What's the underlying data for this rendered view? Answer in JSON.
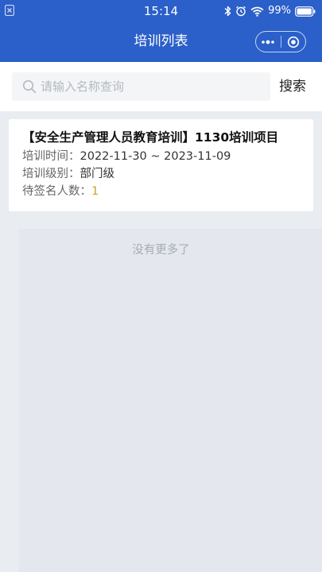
{
  "status_bar": {
    "time": "15:14",
    "battery": "99%",
    "icons": [
      "close-icon",
      "bluetooth-icon",
      "alarm-icon",
      "wifi-icon",
      "battery-icon"
    ]
  },
  "nav": {
    "title": "培训列表",
    "capsule_icons": [
      "more-icon",
      "target-icon"
    ]
  },
  "search": {
    "placeholder": "请输入名称查询",
    "value": "",
    "button_label": "搜索"
  },
  "trainings": [
    {
      "title": "【安全生产管理人员教育培训】1130培训项目",
      "time_label": "培训时间：",
      "time_value": "2022-11-30 ~ 2023-11-09",
      "level_label": "培训级别：",
      "level_value": "部门级",
      "pending_label": "待签名人数：",
      "pending_value": "1"
    }
  ],
  "no_more_text": "没有更多了",
  "colors": {
    "header_blue": "#2b5fc9",
    "page_bg": "#e9edf2",
    "pending_highlight": "#c9a227"
  }
}
